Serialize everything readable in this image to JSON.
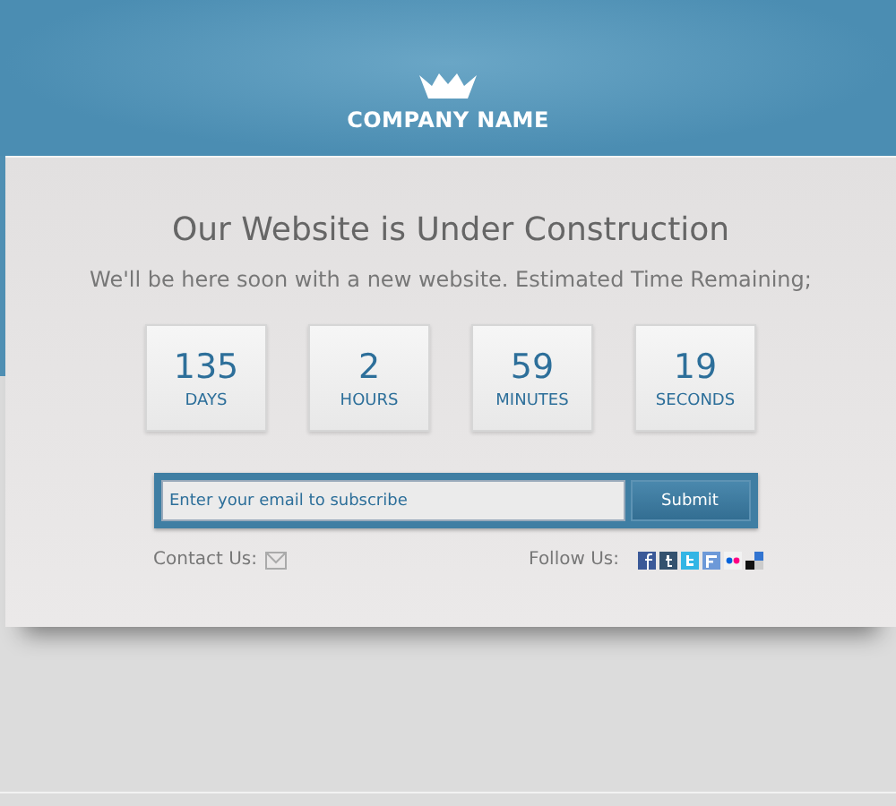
{
  "header": {
    "company_name": "COMPANY NAME"
  },
  "title": "Our Website is Under Construction",
  "subtitle": "We'll be here soon with a new website. Estimated Time Remaining;",
  "countdown": [
    {
      "value": "135",
      "unit": "DAYS"
    },
    {
      "value": "2",
      "unit": "HOURS"
    },
    {
      "value": "59",
      "unit": "MINUTES"
    },
    {
      "value": "19",
      "unit": "SECONDS"
    }
  ],
  "subscribe": {
    "placeholder": "Enter your email to subscribe",
    "button": "Submit"
  },
  "contact": {
    "label": "Contact Us:"
  },
  "follow": {
    "label": "Follow Us:",
    "networks": [
      {
        "kind": "facebook",
        "color": "#3b5998"
      },
      {
        "kind": "tumblr",
        "color": "#34526f"
      },
      {
        "kind": "twitter",
        "color": "#33b5e5"
      },
      {
        "kind": "friendfeed",
        "color": "#6d99d8"
      },
      {
        "kind": "flickr",
        "color": "#ff0084"
      },
      {
        "kind": "delicious",
        "color": "#3274d1"
      }
    ]
  }
}
